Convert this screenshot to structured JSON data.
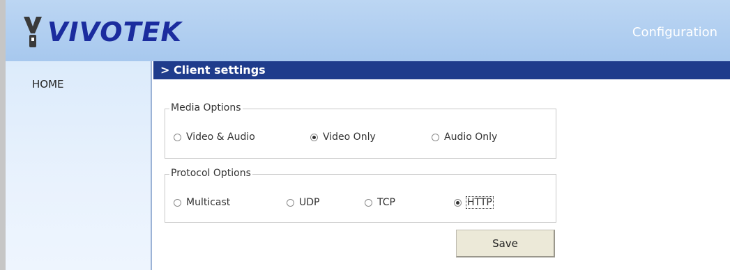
{
  "header": {
    "logo_text": "VIVOTEK",
    "title": "Configuration"
  },
  "sidebar": {
    "items": [
      {
        "label": "HOME"
      }
    ]
  },
  "main": {
    "section_title": "> Client settings",
    "media_options": {
      "legend": "Media Options",
      "options": [
        {
          "label": "Video & Audio",
          "checked": false
        },
        {
          "label": "Video Only",
          "checked": true
        },
        {
          "label": "Audio Only",
          "checked": false
        }
      ]
    },
    "protocol_options": {
      "legend": "Protocol Options",
      "options": [
        {
          "label": "Multicast",
          "checked": false
        },
        {
          "label": "UDP",
          "checked": false
        },
        {
          "label": "TCP",
          "checked": false
        },
        {
          "label": "HTTP",
          "checked": true
        }
      ]
    },
    "save_label": "Save"
  },
  "colors": {
    "header_bg": "#a7c8ee",
    "section_bar": "#1f3c8c",
    "logo": "#1b2c9e",
    "sidebar_bg": "#e9f2fd"
  }
}
